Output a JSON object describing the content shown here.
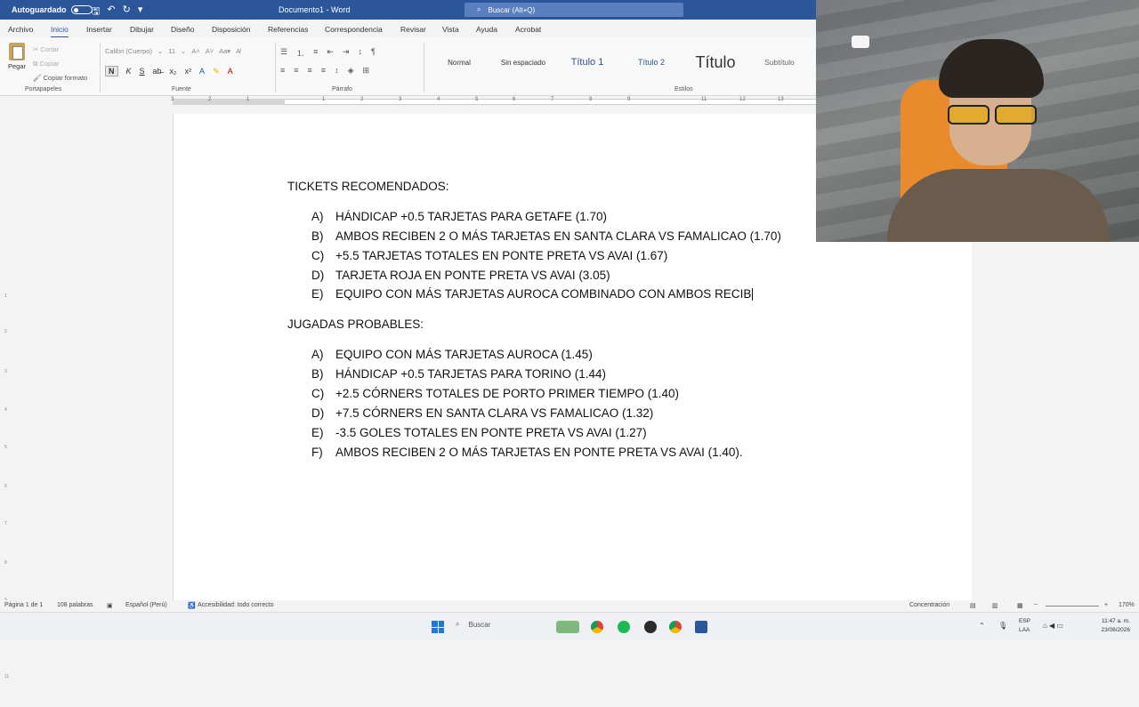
{
  "titlebar": {
    "autosave_label": "Autoguardado",
    "doc_title": "Documento1 - Word",
    "search_placeholder": "Buscar (Alt+Q)"
  },
  "menu": {
    "tabs": [
      "Archivo",
      "Inicio",
      "Insertar",
      "Dibujar",
      "Diseño",
      "Disposición",
      "Referencias",
      "Correspondencia",
      "Revisar",
      "Vista",
      "Ayuda",
      "Acrobat"
    ],
    "active": "Inicio"
  },
  "ribbon": {
    "paste_label": "Pegar",
    "cut_label": "Cortar",
    "copy_label": "Copiar",
    "format_painter_label": "Copiar formato",
    "clipboard_group": "Portapapeles",
    "font_name": "Calibri (Cuerpo)",
    "font_size": "11",
    "font_group": "Fuente",
    "bold": "N",
    "italic": "K",
    "underline": "S",
    "paragraph_group": "Párrafo",
    "styles_group": "Estilos",
    "styles": [
      "Normal",
      "Sin espaciado",
      "Título 1",
      "Título 2",
      "Título",
      "Subtítulo"
    ]
  },
  "document": {
    "section1_title": "TICKETS RECOMENDADOS:",
    "section1_items": [
      {
        "letter": "A)",
        "text": "HÁNDICAP +0.5 TARJETAS PARA GETAFE (1.70)"
      },
      {
        "letter": "B)",
        "text": "AMBOS RECIBEN 2 O MÁS TARJETAS EN SANTA CLARA VS FAMALICAO (1.70)"
      },
      {
        "letter": "C)",
        "text": "+5.5 TARJETAS TOTALES EN PONTE PRETA VS AVAI (1.67)"
      },
      {
        "letter": "D)",
        "text": "TARJETA ROJA EN PONTE PRETA VS AVAI (3.05)"
      },
      {
        "letter": "E)",
        "text": "EQUIPO CON MÁS TARJETAS AUROCA COMBINADO CON AMBOS RECIB"
      }
    ],
    "section2_title": "JUGADAS PROBABLES:",
    "section2_items": [
      {
        "letter": "A)",
        "text": "EQUIPO CON MÁS TARJETAS AUROCA (1.45)"
      },
      {
        "letter": "B)",
        "text": "HÁNDICAP +0.5 TARJETAS PARA TORINO (1.44)"
      },
      {
        "letter": "C)",
        "text": "+2.5 CÓRNERS TOTALES DE PORTO PRIMER TIEMPO (1.40)"
      },
      {
        "letter": "D)",
        "text": "+7.5 CÓRNERS EN SANTA CLARA VS FAMALICAO (1.32)"
      },
      {
        "letter": "E)",
        "text": "-3.5 GOLES TOTALES EN PONTE PRETA VS AVAI (1.27)"
      },
      {
        "letter": "F)",
        "text": "AMBOS RECIBEN 2 O MÁS TARJETAS EN PONTE PRETA VS AVAI (1.40)."
      }
    ]
  },
  "statusbar": {
    "page": "Página 1 de 1",
    "words": "108 palabras",
    "language": "Español (Perú)",
    "accessibility": "Accesibilidad: todo correcto",
    "focus": "Concentración",
    "zoom": "170%"
  },
  "taskbar": {
    "search_label": "Buscar",
    "lang_line1": "ESP",
    "lang_line2": "LAA",
    "time": "11:47 a. m.",
    "date": "23/08/2026"
  },
  "colors": {
    "word_blue": "#2b579a",
    "page_bg": "#ffffff",
    "app_bg": "#f3f3f3"
  }
}
